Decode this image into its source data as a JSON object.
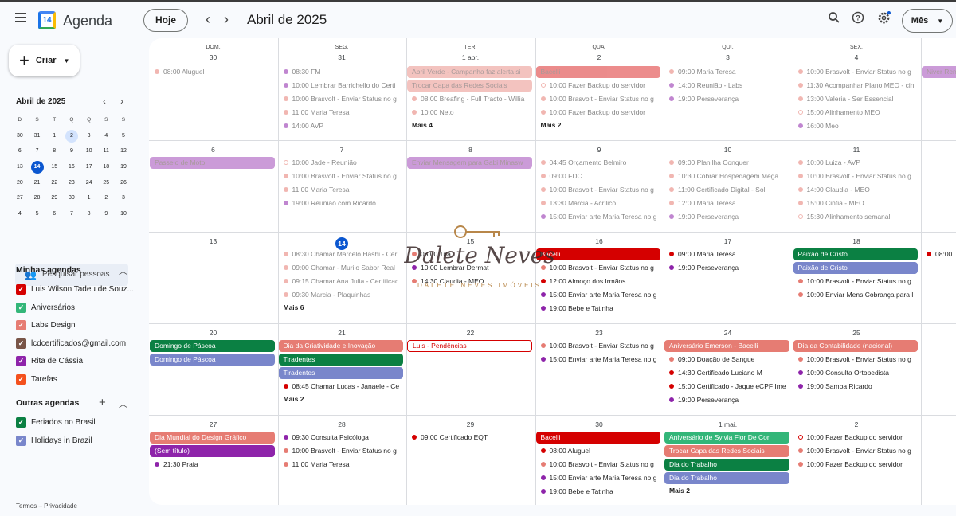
{
  "app": {
    "title": "Agenda",
    "logo_text": "14"
  },
  "header": {
    "today_label": "Hoje",
    "month_title": "Abril de 2025",
    "view_label": "Mês"
  },
  "sidebar": {
    "create_label": "Criar",
    "mini_title": "Abril de 2025",
    "mini_days_head": [
      "D",
      "S",
      "T",
      "Q",
      "Q",
      "S",
      "S"
    ],
    "mini_weeks": [
      [
        "30",
        "31",
        "1",
        "2",
        "3",
        "4",
        "5"
      ],
      [
        "6",
        "7",
        "8",
        "9",
        "10",
        "11",
        "12"
      ],
      [
        "13",
        "14",
        "15",
        "16",
        "17",
        "18",
        "19"
      ],
      [
        "20",
        "21",
        "22",
        "23",
        "24",
        "25",
        "26"
      ],
      [
        "27",
        "28",
        "29",
        "30",
        "1",
        "2",
        "3"
      ],
      [
        "4",
        "5",
        "6",
        "7",
        "8",
        "9",
        "10"
      ]
    ],
    "search_people": "Pesquisar pessoas",
    "my_calendars_title": "Minhas agendas",
    "my_calendars": [
      {
        "label": "Luis Wilson Tadeu de Souz...",
        "color": "#d50000"
      },
      {
        "label": "Aniversários",
        "color": "#33b679"
      },
      {
        "label": "Labs Design",
        "color": "#e67c73"
      },
      {
        "label": "lcdcertificados@gmail.com",
        "color": "#795548"
      },
      {
        "label": "Rita de Cássia",
        "color": "#8e24aa"
      },
      {
        "label": "Tarefas",
        "color": "#f4511e"
      }
    ],
    "other_calendars_title": "Outras agendas",
    "other_calendars": [
      {
        "label": "Feriados no Brasil",
        "color": "#0b8043"
      },
      {
        "label": "Holidays in Brazil",
        "color": "#7986cb"
      }
    ],
    "footer": "Termos – Privacidade"
  },
  "grid": {
    "day_heads": [
      "DOM.",
      "SEG.",
      "TER.",
      "QUA.",
      "QUI.",
      "SEX."
    ],
    "weeks": [
      {
        "days": [
          "30",
          "31",
          "1 abr.",
          "2",
          "3",
          "4"
        ]
      },
      {
        "days": [
          "6",
          "7",
          "8",
          "9",
          "10",
          "11"
        ]
      },
      {
        "days": [
          "13",
          "14",
          "15",
          "16",
          "17",
          "18"
        ]
      },
      {
        "days": [
          "20",
          "21",
          "22",
          "23",
          "24",
          "25"
        ]
      },
      {
        "days": [
          "27",
          "28",
          "29",
          "30",
          "1 mai.",
          "2"
        ]
      }
    ]
  },
  "events": {
    "w0": {
      "d0": [
        {
          "t": "08:00 Aluguel",
          "c": "#e67c73",
          "faded": true
        }
      ],
      "d1": [
        {
          "t": "08:30 FM",
          "c": "#8e24aa",
          "faded": true
        },
        {
          "t": "10:00 Lembrar Barrichello do Certi",
          "c": "#8e24aa",
          "faded": true
        },
        {
          "t": "10:00 Brasvolt - Enviar Status no g",
          "c": "#e67c73",
          "faded": true
        },
        {
          "t": "11:00 Maria Teresa",
          "c": "#e67c73",
          "faded": true
        },
        {
          "t": "14:00 AVP",
          "c": "#8e24aa",
          "faded": true
        }
      ],
      "d2_bars": [
        {
          "t": "Abril Verde - Campanha faz alerta si",
          "c": "#e67c73"
        },
        {
          "t": "Trocar Capa das Redes Sociais",
          "c": "#e67c73"
        }
      ],
      "d2": [
        {
          "t": "08:00 Breafing - Full Tracto - Willia",
          "c": "#e67c73",
          "faded": true
        },
        {
          "t": "10:00 Neto",
          "c": "#e67c73",
          "faded": true
        }
      ],
      "d2_more": "Mais 4",
      "d3_bars": [
        {
          "t": "Bacelli",
          "c": "#d50000"
        }
      ],
      "d3": [
        {
          "t": "10:00 Fazer Backup do servidor",
          "c": "#e67c73",
          "faded": true,
          "ring": true
        },
        {
          "t": "10:00 Brasvolt - Enviar Status no g",
          "c": "#e67c73",
          "faded": true
        },
        {
          "t": "10:00 Fazer Backup do servidor",
          "c": "#e67c73",
          "faded": true
        }
      ],
      "d3_more": "Mais 2",
      "d4": [
        {
          "t": "09:00 Maria Teresa",
          "c": "#e67c73",
          "faded": true
        },
        {
          "t": "14:00 Reunião - Labs",
          "c": "#8e24aa",
          "faded": true
        },
        {
          "t": "19:00 Perseverança",
          "c": "#8e24aa",
          "faded": true
        }
      ],
      "d5": [
        {
          "t": "10:00 Brasvolt - Enviar Status no g",
          "c": "#e67c73",
          "faded": true
        },
        {
          "t": "11:30 Acompanhar Plano MEO - cin",
          "c": "#e67c73",
          "faded": true
        },
        {
          "t": "13:00 Valeria - Ser Essencial",
          "c": "#e67c73",
          "faded": true
        },
        {
          "t": "15:00 Alinhamento MEO",
          "c": "#e67c73",
          "faded": true,
          "ring": true
        },
        {
          "t": "16:00 Meo",
          "c": "#8e24aa",
          "faded": true
        }
      ],
      "d6_bars": [
        {
          "t": "Niver Renata",
          "c": "#8e24aa"
        }
      ]
    },
    "w1": {
      "d0_bars": [
        {
          "t": "Passeio de Moto",
          "c": "#8e24aa"
        }
      ],
      "d1": [
        {
          "t": "10:00 Jade - Reunião",
          "c": "#e67c73",
          "faded": true,
          "ring": true
        },
        {
          "t": "10:00 Brasvolt - Enviar Status no g",
          "c": "#e67c73",
          "faded": true
        },
        {
          "t": "11:00 Maria Teresa",
          "c": "#e67c73",
          "faded": true
        },
        {
          "t": "19:00 Reunião com Ricardo",
          "c": "#8e24aa",
          "faded": true
        }
      ],
      "d2_bars": [
        {
          "t": "Enviar Mensagem para Gabi Minasw",
          "c": "#8e24aa"
        }
      ],
      "d3": [
        {
          "t": "04:45 Orçamento Belmiro",
          "c": "#e67c73",
          "faded": true
        },
        {
          "t": "09:00 FDC",
          "c": "#e67c73",
          "faded": true
        },
        {
          "t": "10:00 Brasvolt - Enviar Status no g",
          "c": "#e67c73",
          "faded": true
        },
        {
          "t": "13:30 Marcia - Acrilico",
          "c": "#e67c73",
          "faded": true
        },
        {
          "t": "15:00 Enviar arte Maria Teresa no g",
          "c": "#8e24aa",
          "faded": true
        }
      ],
      "d4": [
        {
          "t": "09:00 Planilha Conquer",
          "c": "#e67c73",
          "faded": true
        },
        {
          "t": "10:30 Cobrar Hospedagem Mega",
          "c": "#e67c73",
          "faded": true
        },
        {
          "t": "11:00 Certificado Digital - Sol",
          "c": "#e67c73",
          "faded": true
        },
        {
          "t": "12:00 Maria Teresa",
          "c": "#e67c73",
          "faded": true
        },
        {
          "t": "19:00 Perseverança",
          "c": "#8e24aa",
          "faded": true
        }
      ],
      "d5": [
        {
          "t": "10:00 Luiza - AVP",
          "c": "#e67c73",
          "faded": true
        },
        {
          "t": "10:00 Brasvolt - Enviar Status no g",
          "c": "#e67c73",
          "faded": true
        },
        {
          "t": "14:00 Claudia - MEO",
          "c": "#e67c73",
          "faded": true
        },
        {
          "t": "15:00 Cintia - MEO",
          "c": "#e67c73",
          "faded": true
        },
        {
          "t": "15:30 Alinhamento semanal",
          "c": "#e67c73",
          "faded": true,
          "ring": true
        }
      ]
    },
    "w2": {
      "d1": [
        {
          "t": "08:30 Chamar Marcelo Hashi - Cer",
          "c": "#e67c73",
          "faded": true
        },
        {
          "t": "09:00 Chamar - Murilo Sabor Real",
          "c": "#e67c73",
          "faded": true
        },
        {
          "t": "09:15 Chamar Ana Julia - Certificac",
          "c": "#e67c73",
          "faded": true
        },
        {
          "t": "09:30 Marcia - Plaquinhas",
          "c": "#e67c73",
          "faded": true
        }
      ],
      "d1_more": "Mais 6",
      "d2": [
        {
          "t": "08:00 Tira",
          "c": "#e67c73"
        },
        {
          "t": "10:00 Lembrar Dermat",
          "c": "#8e24aa"
        },
        {
          "t": "14:30 Claudia - MEO",
          "c": "#e67c73"
        }
      ],
      "d3_bars": [
        {
          "t": "Bacelli",
          "c": "#d50000"
        }
      ],
      "d3": [
        {
          "t": "10:00 Brasvolt - Enviar Status no g",
          "c": "#e67c73"
        },
        {
          "t": "12:00 Almoço dos Irmãos",
          "c": "#d50000"
        },
        {
          "t": "15:00 Enviar arte Maria Teresa no g",
          "c": "#8e24aa"
        },
        {
          "t": "19:00 Bebe e Tatinha",
          "c": "#8e24aa"
        }
      ],
      "d4": [
        {
          "t": "09:00 Maria Teresa",
          "c": "#d50000"
        },
        {
          "t": "19:00 Perseverança",
          "c": "#8e24aa"
        }
      ],
      "d5_bars": [
        {
          "t": "Paixão de Cristo",
          "c": "#0b8043"
        },
        {
          "t": "Paixão de Cristo",
          "c": "#7986cb"
        }
      ],
      "d5": [
        {
          "t": "10:00 Brasvolt - Enviar Status no g",
          "c": "#e67c73"
        },
        {
          "t": "10:00 Enviar Mens Cobrança para l",
          "c": "#e67c73"
        }
      ],
      "d6": [
        {
          "t": "08:00",
          "c": "#d50000"
        }
      ]
    },
    "w3": {
      "d0_bars": [
        {
          "t": "Domingo de Páscoa",
          "c": "#0b8043"
        },
        {
          "t": "Domingo de Páscoa",
          "c": "#7986cb"
        }
      ],
      "d1_bars": [
        {
          "t": "Dia da Criatividade e Inovação",
          "c": "#e67c73"
        },
        {
          "t": "Tiradentes",
          "c": "#0b8043"
        },
        {
          "t": "Tiradentes",
          "c": "#7986cb"
        }
      ],
      "d1": [
        {
          "t": "08:45 Chamar Lucas - Janaele - Ce",
          "c": "#d50000"
        }
      ],
      "d1_more": "Mais 2",
      "d2_outline": {
        "t": "Luis - Pendências",
        "c": "#d50000"
      },
      "d3": [
        {
          "t": "10:00 Brasvolt - Enviar Status no g",
          "c": "#e67c73"
        },
        {
          "t": "15:00 Enviar arte Maria Teresa no g",
          "c": "#8e24aa"
        }
      ],
      "d4_bars": [
        {
          "t": "Aniversário Emerson - Bacelli",
          "c": "#e67c73"
        }
      ],
      "d4": [
        {
          "t": "09:00 Doação de Sangue",
          "c": "#e67c73"
        },
        {
          "t": "14:30 Certificado Luciano M",
          "c": "#d50000"
        },
        {
          "t": "15:00 Certificado - Jaque eCPF Ime",
          "c": "#d50000"
        },
        {
          "t": "19:00 Perseverança",
          "c": "#8e24aa"
        }
      ],
      "d5_bars": [
        {
          "t": "Dia da Contabilidade (nacional)",
          "c": "#e67c73"
        }
      ],
      "d5": [
        {
          "t": "10:00 Brasvolt - Enviar Status no g",
          "c": "#e67c73"
        },
        {
          "t": "10:00 Consulta Ortopedista",
          "c": "#8e24aa"
        },
        {
          "t": "19:00 Samba Ricardo",
          "c": "#8e24aa"
        }
      ]
    },
    "w4": {
      "d0_bars": [
        {
          "t": "Dia Mundial do Design Gráfico",
          "c": "#e67c73"
        },
        {
          "t": "(Sem título)",
          "c": "#8e24aa"
        }
      ],
      "d0": [
        {
          "t": "21:30 Praia",
          "c": "#8e24aa"
        }
      ],
      "d1": [
        {
          "t": "09:30 Consulta Psicóloga",
          "c": "#8e24aa"
        },
        {
          "t": "10:00 Brasvolt - Enviar Status no g",
          "c": "#e67c73"
        },
        {
          "t": "11:00 Maria Teresa",
          "c": "#e67c73"
        }
      ],
      "d2": [
        {
          "t": "09:00 Certificado EQT",
          "c": "#d50000"
        }
      ],
      "d3_bars": [
        {
          "t": "Bacelli",
          "c": "#d50000"
        }
      ],
      "d3": [
        {
          "t": "08:00 Aluguel",
          "c": "#d50000"
        },
        {
          "t": "10:00 Brasvolt - Enviar Status no g",
          "c": "#e67c73"
        },
        {
          "t": "15:00 Enviar arte Maria Teresa no g",
          "c": "#8e24aa"
        },
        {
          "t": "19:00 Bebe e Tatinha",
          "c": "#8e24aa"
        }
      ],
      "d4_bars": [
        {
          "t": "Aniversário de Sylvia Flor De Cor",
          "c": "#33b679"
        },
        {
          "t": "Trocar Capa das Redes Sociais",
          "c": "#e67c73"
        },
        {
          "t": "Dia do Trabalho",
          "c": "#0b8043"
        },
        {
          "t": "Dia do Trabalho",
          "c": "#7986cb"
        }
      ],
      "d4_more": "Mais 2",
      "d5": [
        {
          "t": "10:00 Fazer Backup do servidor",
          "c": "#d50000",
          "ring": true
        },
        {
          "t": "10:00 Brasvolt - Enviar Status no g",
          "c": "#e67c73"
        },
        {
          "t": "10:00 Fazer Backup do servidor",
          "c": "#e67c73"
        }
      ]
    }
  },
  "watermark": {
    "name": "Dalete Neves",
    "sub": "DALETE NEVES IMÓVEIS"
  },
  "icons": {
    "search": "search-icon",
    "help": "help-icon",
    "settings": "gear-icon",
    "menu": "menu-icon"
  }
}
